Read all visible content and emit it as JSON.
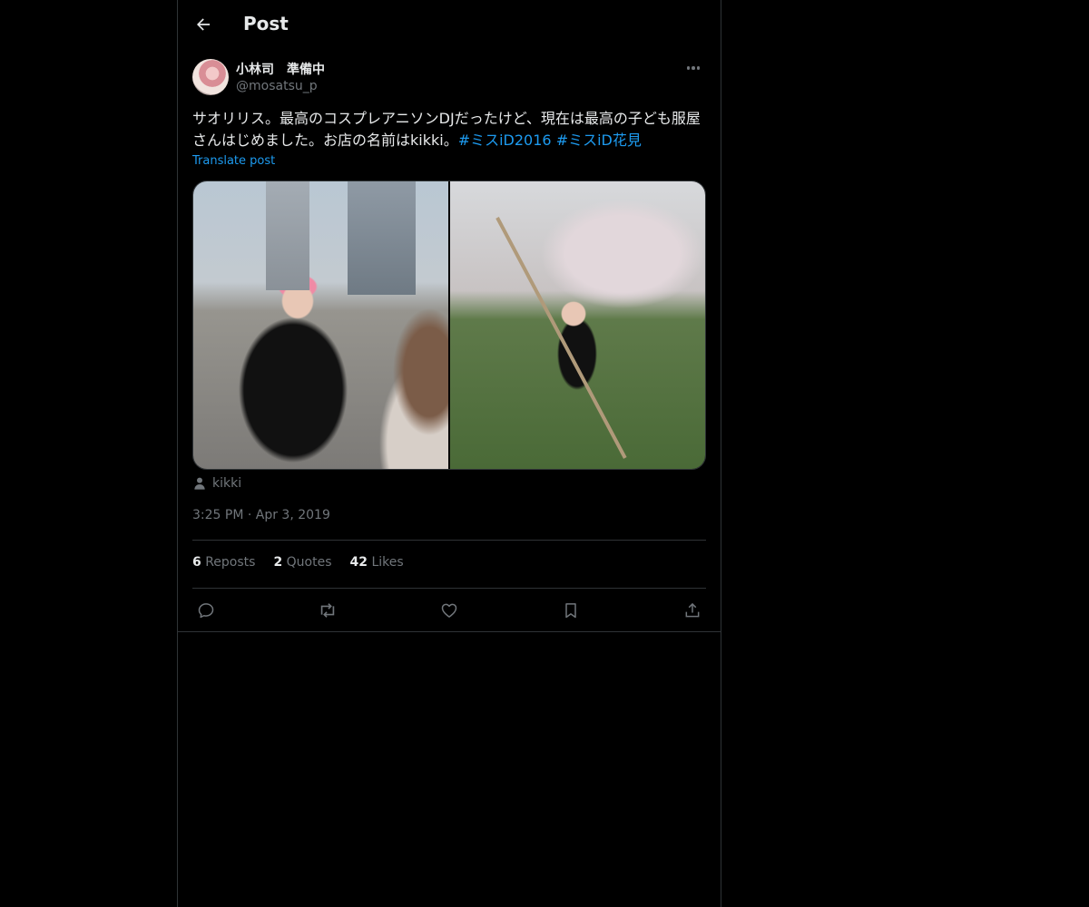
{
  "header": {
    "title": "Post",
    "back_icon": "arrow-left-icon"
  },
  "author": {
    "display_name": "小林司　準備中",
    "handle": "@mosatsu_p"
  },
  "post": {
    "text": "サオリリス。最高のコスプレアニソンDJだったけど、現在は最高の子ども服屋さんはじめました。お店の名前はkikki。",
    "hashtags": [
      "#ミスiD2016",
      "#ミスiD花見"
    ],
    "translate_label": "Translate post",
    "tagged_person": "kikki",
    "timestamp": "3:25 PM · Apr 3, 2019"
  },
  "stats": [
    {
      "count": "6",
      "label": "Reposts"
    },
    {
      "count": "2",
      "label": "Quotes"
    },
    {
      "count": "42",
      "label": "Likes"
    }
  ],
  "actions": [
    "reply-icon",
    "repost-icon",
    "like-icon",
    "bookmark-icon",
    "share-icon"
  ],
  "colors": {
    "background": "#000000",
    "text": "#e7e9ea",
    "muted": "#71767b",
    "accent": "#1d9bf0",
    "border": "#2f3336"
  }
}
